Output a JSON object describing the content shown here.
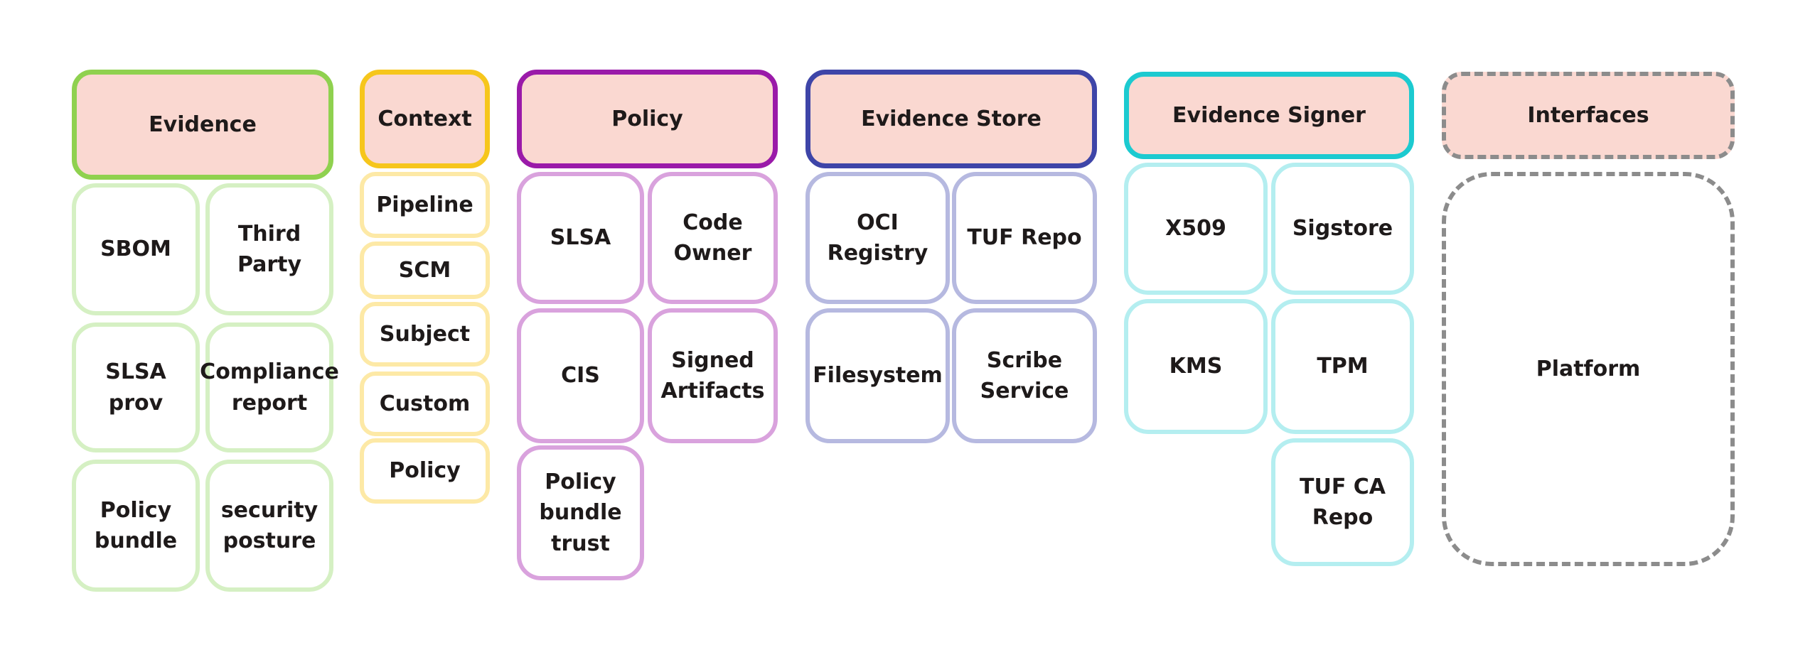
{
  "colors": {
    "header_fill": "#fad8d1",
    "evidence": {
      "strong": "#8fd14f",
      "light": "#d5f0c3"
    },
    "context": {
      "strong": "#f6c61c",
      "light": "#fde9a6"
    },
    "policy": {
      "strong": "#9a1aa9",
      "light": "#d9a2dd"
    },
    "evidence_store": {
      "strong": "#3e45a8",
      "light": "#b6b9e0"
    },
    "evidence_signer": {
      "strong": "#1ccad0",
      "light": "#b4eef0"
    },
    "interfaces": {
      "strong": "#8c8c8c",
      "line_style": "dashed"
    }
  },
  "groups": [
    {
      "key": "evidence",
      "title": "Evidence",
      "items": [
        "SBOM",
        "Third\nParty",
        "SLSA\nprov",
        "Compliance\nreport",
        "Policy\nbundle",
        "security\nposture"
      ]
    },
    {
      "key": "context",
      "title": "Context",
      "items": [
        "Pipeline",
        "SCM",
        "Subject",
        "Custom",
        "Policy"
      ]
    },
    {
      "key": "policy",
      "title": "Policy",
      "items": [
        "SLSA",
        "Code\nOwner",
        "CIS",
        "Signed\nArtifacts",
        "Policy\nbundle\ntrust"
      ]
    },
    {
      "key": "evidence_store",
      "title": "Evidence Store",
      "items": [
        "OCI\nRegistry",
        "TUF Repo",
        "Filesystem",
        "Scribe\nService"
      ]
    },
    {
      "key": "evidence_signer",
      "title": "Evidence Signer",
      "items": [
        "X509",
        "Sigstore",
        "KMS",
        "TPM",
        "TUF CA\nRepo"
      ]
    },
    {
      "key": "interfaces",
      "title": "Interfaces",
      "items": [
        "Platform"
      ]
    }
  ]
}
